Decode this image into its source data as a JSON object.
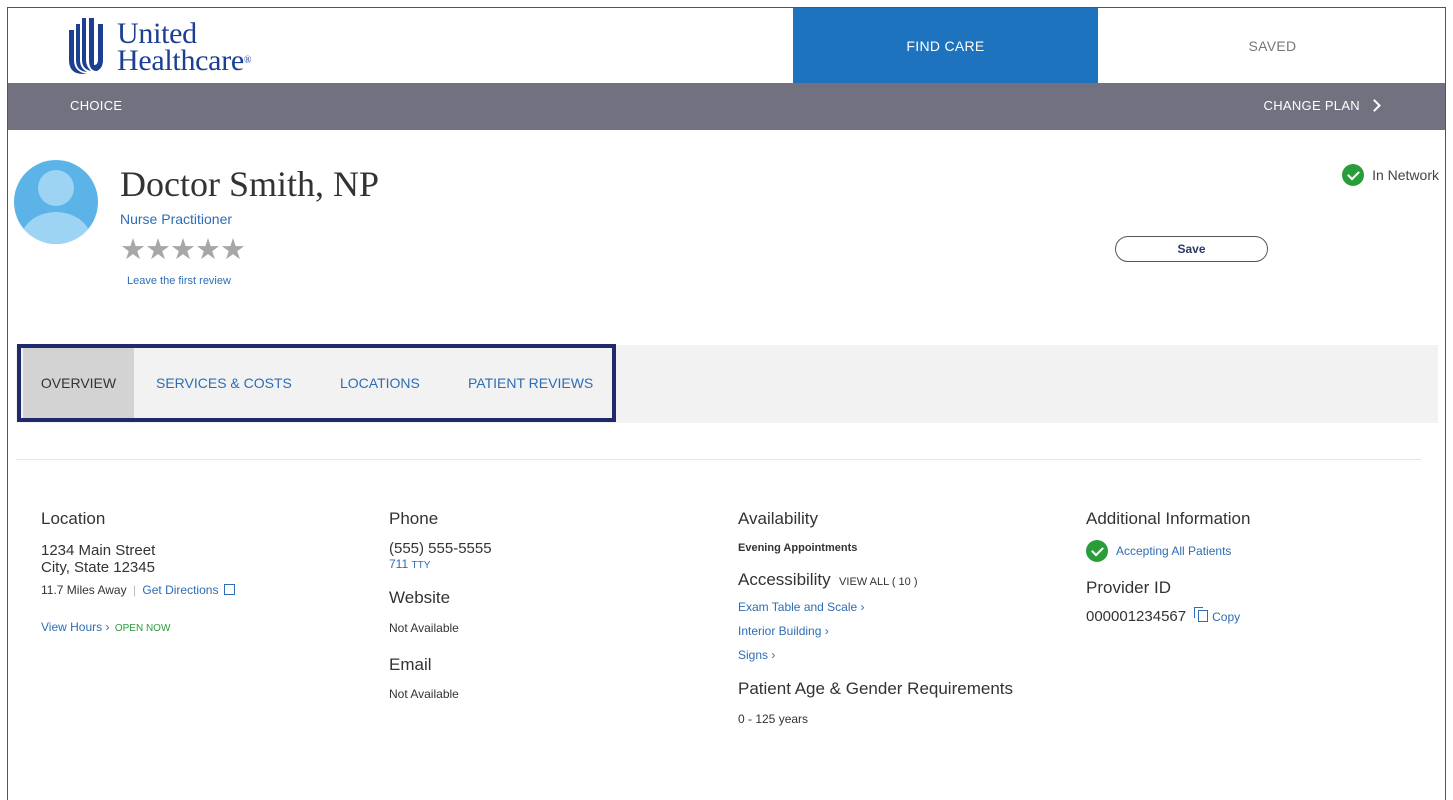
{
  "brand": {
    "line1": "United",
    "line2": "Healthcare"
  },
  "nav": {
    "find_care": "FIND CARE",
    "saved": "SAVED"
  },
  "plan_bar": {
    "plan": "CHOICE",
    "change_plan": "CHANGE PLAN"
  },
  "provider": {
    "name": "Doctor Smith, NP",
    "type": "Nurse Practitioner",
    "stars": "★★★★★",
    "rating": 0,
    "review_link": "Leave the first review",
    "network_status": "In Network",
    "save_label": "Save"
  },
  "tabs": [
    {
      "label": "OVERVIEW",
      "active": true
    },
    {
      "label": "SERVICES & COSTS",
      "active": false
    },
    {
      "label": "LOCATIONS",
      "active": false
    },
    {
      "label": "PATIENT REVIEWS",
      "active": false
    }
  ],
  "location": {
    "heading": "Location",
    "address1": "1234 Main Street",
    "address2": "City, State 12345",
    "distance": "11.7 Miles Away",
    "separator": "|",
    "directions": "Get Directions",
    "view_hours": "View Hours",
    "open_status": "OPEN NOW"
  },
  "contact": {
    "phone_heading": "Phone",
    "phone": "(555) 555-5555",
    "tty": "711",
    "tty_label": "TTY",
    "website_heading": "Website",
    "website": "Not Available",
    "email_heading": "Email",
    "email": "Not Available"
  },
  "availability": {
    "heading": "Availability",
    "value": "Evening Appointments",
    "accessibility_heading": "Accessibility",
    "view_all": "VIEW ALL ( 10 )",
    "items": [
      "Exam Table and Scale",
      "Interior Building",
      "Signs"
    ],
    "age_heading": "Patient Age & Gender Requirements",
    "age_value": "0 - 125 years"
  },
  "additional": {
    "heading": "Additional Information",
    "accepting": "Accepting All Patients",
    "provider_id_heading": "Provider ID",
    "provider_id": "000001234567",
    "copy": "Copy"
  },
  "colors": {
    "brand_blue": "#1c3f94",
    "nav_active": "#1e73be",
    "plan_bar": "#717180",
    "link": "#2e6db4",
    "success": "#2a9d3b",
    "tab_outline": "#1f2a6e"
  }
}
